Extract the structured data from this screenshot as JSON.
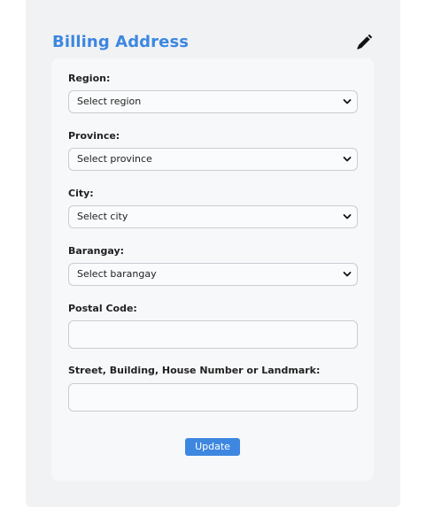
{
  "billing": {
    "title": "Billing Address",
    "edit_icon": "pencil-icon",
    "region": {
      "label": "Region:",
      "placeholder": "Select region"
    },
    "province": {
      "label": "Province:",
      "placeholder": "Select province"
    },
    "city": {
      "label": "City:",
      "placeholder": "Select city"
    },
    "barangay": {
      "label": "Barangay:",
      "placeholder": "Select barangay"
    },
    "postal": {
      "label": "Postal Code:",
      "value": ""
    },
    "street": {
      "label": "Street, Building, House Number or Landmark:",
      "value": ""
    },
    "update_label": "Update"
  },
  "colors": {
    "accent": "#3d87e0",
    "card_bg": "#f1f2f4",
    "form_bg": "#f7f8fa"
  }
}
